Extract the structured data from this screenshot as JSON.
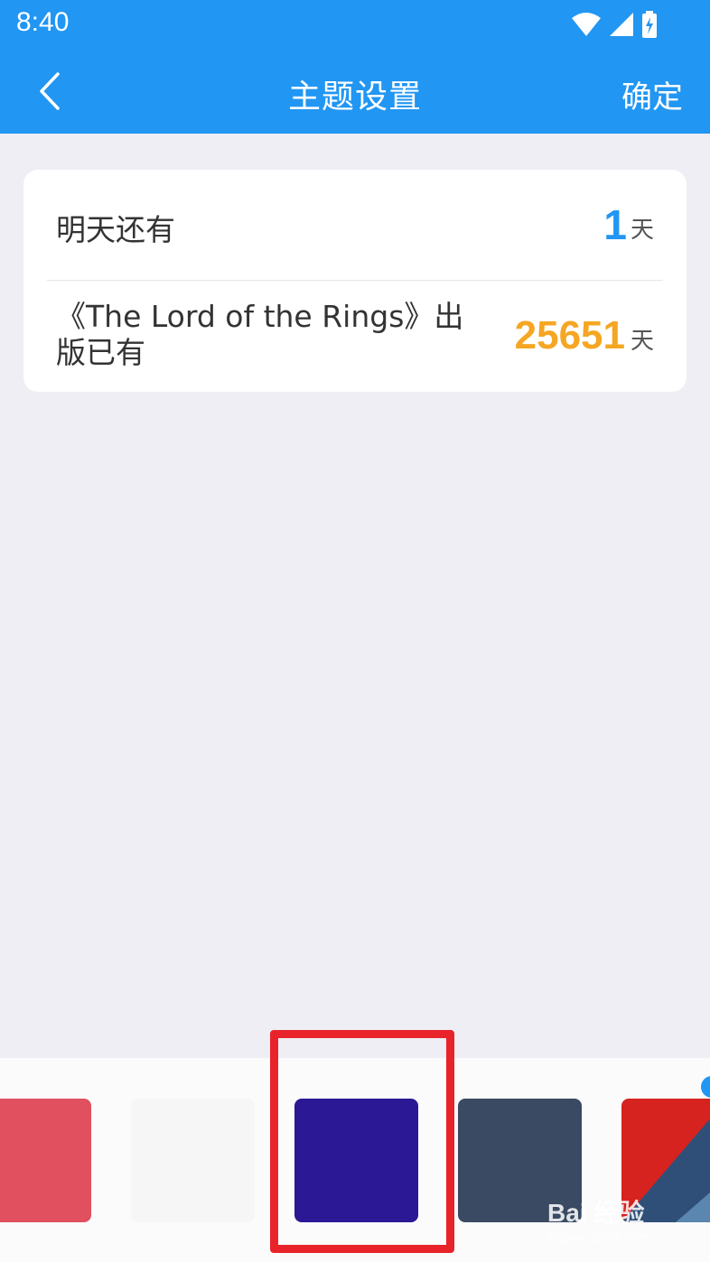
{
  "status_bar": {
    "time": "8:40",
    "icons": [
      "wifi-icon",
      "signal-icon",
      "battery-charging-icon"
    ]
  },
  "title_bar": {
    "title": "主题设置",
    "confirm_label": "确定",
    "back_icon": "chevron-left-icon"
  },
  "countdown": {
    "items": [
      {
        "label": "明天还有",
        "value": "1",
        "unit": "天",
        "value_color": "#2196f3"
      },
      {
        "label": "《The Lord of the Rings》出版已有",
        "value": "25651",
        "unit": "天",
        "value_color": "#f5a623"
      }
    ]
  },
  "themes": {
    "swatches": [
      {
        "name": "red",
        "color": "#e0505f"
      },
      {
        "name": "white",
        "color": "#f6f6f7"
      },
      {
        "name": "indigo",
        "color": "#2b1894",
        "selected": true
      },
      {
        "name": "slate",
        "color": "#3b4a63"
      },
      {
        "name": "red-geometric",
        "color": "#d6231f"
      }
    ]
  },
  "watermark": {
    "text": "Bai 经验",
    "sub": "jingyan.baidu.com"
  },
  "colors": {
    "primary": "#2196f3",
    "highlight": "#e8232a",
    "background": "#eeeef4"
  }
}
